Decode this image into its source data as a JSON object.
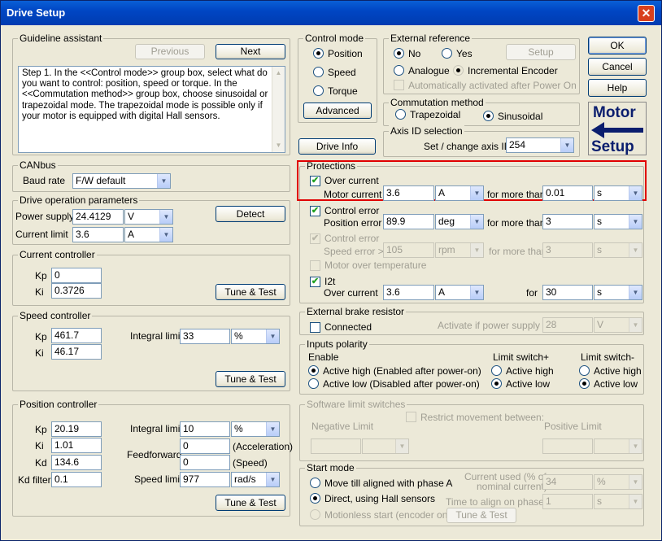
{
  "window": {
    "title": "Drive Setup",
    "close_glyph": "✕"
  },
  "dialog": {
    "ok": "OK",
    "cancel": "Cancel",
    "help": "Help"
  },
  "guideline": {
    "title": "Guideline assistant",
    "previous": "Previous",
    "next": "Next",
    "text": "Step 1.    In the <<Control mode>> group box, select what do you want to control: position, speed or torque.  In the <<Commutation method>> group box, choose sinusoidal or trapezoidal mode. The trapezoidal mode is possible only if your motor is equipped with digital Hall sensors."
  },
  "canbus": {
    "title": "CANbus",
    "baud_label": "Baud rate",
    "baud_value": "F/W default"
  },
  "drive_params": {
    "title": "Drive operation parameters",
    "supply_label": "Power supply",
    "supply_value": "24.4129",
    "supply_unit": "V",
    "limit_label": "Current limit",
    "limit_value": "3.6",
    "limit_unit": "A",
    "detect": "Detect"
  },
  "current_ctrl": {
    "title": "Current controller",
    "kp_label": "Kp",
    "kp": "0",
    "ki_label": "Ki",
    "ki": "0.3726",
    "tune": "Tune & Test"
  },
  "speed_ctrl": {
    "title": "Speed controller",
    "kp_label": "Kp",
    "kp": "461.7",
    "ki_label": "Ki",
    "ki": "46.17",
    "int_label": "Integral limit",
    "int_value": "33",
    "int_unit": "%",
    "tune": "Tune & Test"
  },
  "position_ctrl": {
    "title": "Position controller",
    "kp_label": "Kp",
    "kp": "20.19",
    "ki_label": "Ki",
    "ki": "1.01",
    "kd_label": "Kd",
    "kd": "134.6",
    "kdf_label": "Kd filter",
    "kdf": "0.1",
    "int_label": "Integral limit",
    "int_value": "10",
    "int_unit": "%",
    "ff_label": "Feedforward",
    "ff_acc": "0",
    "ff_acc_unit": "(Acceleration)",
    "ff_spd": "0",
    "ff_spd_unit": "(Speed)",
    "spd_label": "Speed limit",
    "spd_value": "977",
    "spd_unit": "rad/s",
    "tune": "Tune & Test"
  },
  "control_mode": {
    "title": "Control mode",
    "position": "Position",
    "speed": "Speed",
    "torque": "Torque",
    "advanced": "Advanced"
  },
  "ext_ref": {
    "title": "External reference",
    "no": "No",
    "yes": "Yes",
    "setup": "Setup",
    "analogue": "Analogue",
    "encoder": "Incremental Encoder",
    "auto": "Automatically activated after Power On"
  },
  "commutation": {
    "title": "Commutation method",
    "trap": "Trapezoidal",
    "sin": "Sinusoidal"
  },
  "logo": {
    "line1": "Motor",
    "line2": "Setup"
  },
  "drive_info": "Drive Info",
  "axis": {
    "title": "Axis ID selection",
    "label": "Set / change axis ID",
    "value": "254"
  },
  "protections": {
    "title": "Protections",
    "oc_label": "Over current",
    "oc_sub": "Motor current >",
    "oc_value": "3.6",
    "oc_unit": "A",
    "oc_more": "for more than",
    "oc_time": "0.01",
    "oc_time_unit": "s",
    "ce_label": "Control error",
    "ce_sub": "Position error >",
    "ce_value": "89.9",
    "ce_unit": "deg",
    "ce_more": "for more than",
    "ce_time": "3",
    "ce_time_unit": "s",
    "se_label": "Control error",
    "se_sub": "Speed error >",
    "se_value": "105",
    "se_unit": "rpm",
    "se_more": "for more than",
    "se_time": "3",
    "se_time_unit": "s",
    "temp_label": "Motor over temperature",
    "i2t_label": "I2t",
    "i2t_sub": "Over current",
    "i2t_value": "3.6",
    "i2t_unit": "A",
    "i2t_for": "for",
    "i2t_time": "30",
    "i2t_time_unit": "s"
  },
  "brake": {
    "title": "External brake resistor",
    "connected": "Connected",
    "activate": "Activate if power supply >",
    "value": "28",
    "unit": "V"
  },
  "polarity": {
    "title": "Inputs polarity",
    "enable": "Enable",
    "en_high": "Active high (Enabled after power-on)",
    "en_low": "Active low (Disabled after power-on)",
    "lsp": "Limit switch+",
    "lsp_high": "Active high",
    "lsp_low": "Active low",
    "lsm": "Limit switch-",
    "lsm_high": "Active high",
    "lsm_low": "Active low"
  },
  "soft_limits": {
    "title": "Software limit switches",
    "restrict": "Restrict movement between:",
    "neg": "Negative Limit",
    "pos": "Positive Limit"
  },
  "start_mode": {
    "title": "Start mode",
    "opt1": "Move till aligned with phase A",
    "opt2": "Direct, using Hall sensors",
    "opt3": "Motionless start (encoder only)",
    "cur_label1": "Current used (% of",
    "cur_label2": "nominal current)",
    "cur_value": "34",
    "cur_unit": "%",
    "time_label": "Time to align on phases",
    "time_value": "1",
    "time_unit": "s",
    "tune": "Tune & Test"
  }
}
